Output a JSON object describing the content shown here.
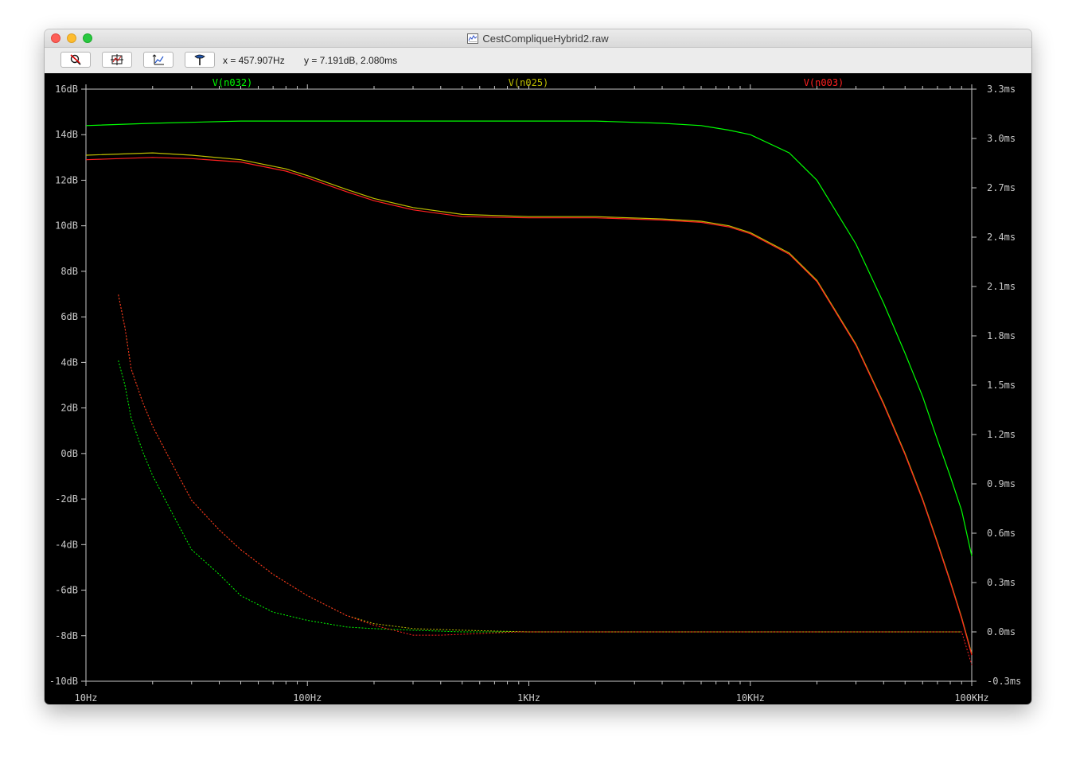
{
  "window": {
    "title": "CestCompliqueHybrid2.raw"
  },
  "toolbar": {
    "buttons": [
      {
        "name": "zoom-cancel-button",
        "icon": "zoom-cancel-icon"
      },
      {
        "name": "autorange-button",
        "icon": "autorange-icon"
      },
      {
        "name": "autorange-y-button",
        "icon": "autorange-y-icon"
      },
      {
        "name": "marker-button",
        "icon": "marker-icon"
      }
    ],
    "x_readout": "x = 457.907Hz",
    "y_readout": "y = 7.191dB, 2.080ms"
  },
  "colors": {
    "background": "#000000",
    "axis": "#c8c8c8",
    "grid": "#404040",
    "v_n032": "#00ff00",
    "v_n025": "#bfbf00",
    "v_n003": "#ff2020"
  },
  "chart_data": {
    "type": "line",
    "xscale": "log",
    "xlim_hz": [
      10,
      100000
    ],
    "x_tick_labels": [
      "10Hz",
      "100Hz",
      "1KHz",
      "10KHz",
      "100KHz"
    ],
    "left_ylim_db": [
      -10,
      16
    ],
    "left_tick_labels": [
      "16dB",
      "14dB",
      "12dB",
      "10dB",
      "8dB",
      "6dB",
      "4dB",
      "2dB",
      "0dB",
      "-2dB",
      "-4dB",
      "-6dB",
      "-8dB",
      "-10dB"
    ],
    "right_ylim_ms": [
      -0.3,
      3.3
    ],
    "right_tick_labels": [
      "3.3ms",
      "3.0ms",
      "2.7ms",
      "2.4ms",
      "2.1ms",
      "1.8ms",
      "1.5ms",
      "1.2ms",
      "0.9ms",
      "0.6ms",
      "0.3ms",
      "0.0ms",
      "-0.3ms"
    ],
    "legend": [
      "V(n032)",
      "V(n025)",
      "V(n003)"
    ],
    "series": [
      {
        "name": "V(n032)",
        "magnitude_db": [
          [
            10,
            14.4
          ],
          [
            20,
            14.5
          ],
          [
            50,
            14.6
          ],
          [
            100,
            14.6
          ],
          [
            200,
            14.6
          ],
          [
            500,
            14.6
          ],
          [
            1000,
            14.6
          ],
          [
            2000,
            14.6
          ],
          [
            4000,
            14.5
          ],
          [
            6000,
            14.4
          ],
          [
            8000,
            14.2
          ],
          [
            10000,
            14.0
          ],
          [
            15000,
            13.2
          ],
          [
            20000,
            12.0
          ],
          [
            30000,
            9.2
          ],
          [
            40000,
            6.6
          ],
          [
            50000,
            4.4
          ],
          [
            60000,
            2.5
          ],
          [
            70000,
            0.6
          ],
          [
            80000,
            -1.0
          ],
          [
            90000,
            -2.5
          ],
          [
            100000,
            -4.5
          ]
        ],
        "group_delay_ms": [
          [
            14,
            1.65
          ],
          [
            15,
            1.5
          ],
          [
            16,
            1.3
          ],
          [
            18,
            1.1
          ],
          [
            20,
            0.95
          ],
          [
            25,
            0.7
          ],
          [
            30,
            0.5
          ],
          [
            40,
            0.35
          ],
          [
            50,
            0.22
          ],
          [
            70,
            0.12
          ],
          [
            100,
            0.07
          ],
          [
            150,
            0.03
          ],
          [
            200,
            0.02
          ],
          [
            300,
            0.01
          ],
          [
            500,
            0.0
          ],
          [
            1000,
            0.0
          ],
          [
            10000,
            0.0
          ],
          [
            90000,
            0.0
          ]
        ]
      },
      {
        "name": "V(n025)",
        "magnitude_db": [
          [
            10,
            13.1
          ],
          [
            20,
            13.2
          ],
          [
            30,
            13.1
          ],
          [
            50,
            12.9
          ],
          [
            80,
            12.5
          ],
          [
            100,
            12.2
          ],
          [
            150,
            11.6
          ],
          [
            200,
            11.2
          ],
          [
            300,
            10.8
          ],
          [
            500,
            10.5
          ],
          [
            1000,
            10.4
          ],
          [
            2000,
            10.4
          ],
          [
            4000,
            10.3
          ],
          [
            6000,
            10.2
          ],
          [
            8000,
            10.0
          ],
          [
            10000,
            9.7
          ],
          [
            15000,
            8.8
          ],
          [
            20000,
            7.6
          ],
          [
            30000,
            4.8
          ],
          [
            40000,
            2.2
          ],
          [
            50000,
            0.0
          ],
          [
            60000,
            -2.0
          ],
          [
            70000,
            -3.9
          ],
          [
            80000,
            -5.6
          ],
          [
            90000,
            -7.2
          ],
          [
            100000,
            -8.8
          ]
        ],
        "group_delay_ms": [
          [
            14,
            2.05
          ],
          [
            15,
            1.85
          ],
          [
            16,
            1.6
          ],
          [
            18,
            1.4
          ],
          [
            20,
            1.25
          ],
          [
            25,
            1.0
          ],
          [
            30,
            0.8
          ],
          [
            40,
            0.62
          ],
          [
            50,
            0.5
          ],
          [
            70,
            0.35
          ],
          [
            100,
            0.22
          ],
          [
            150,
            0.1
          ],
          [
            200,
            0.05
          ],
          [
            300,
            0.02
          ],
          [
            500,
            0.01
          ],
          [
            1000,
            0.0
          ],
          [
            10000,
            0.0
          ],
          [
            90000,
            0.0
          ]
        ]
      },
      {
        "name": "V(n003)",
        "magnitude_db": [
          [
            10,
            12.9
          ],
          [
            20,
            13.0
          ],
          [
            30,
            12.95
          ],
          [
            50,
            12.8
          ],
          [
            80,
            12.4
          ],
          [
            100,
            12.1
          ],
          [
            150,
            11.5
          ],
          [
            200,
            11.1
          ],
          [
            300,
            10.7
          ],
          [
            500,
            10.4
          ],
          [
            1000,
            10.35
          ],
          [
            2000,
            10.35
          ],
          [
            4000,
            10.25
          ],
          [
            6000,
            10.15
          ],
          [
            8000,
            9.95
          ],
          [
            10000,
            9.65
          ],
          [
            15000,
            8.75
          ],
          [
            20000,
            7.55
          ],
          [
            30000,
            4.75
          ],
          [
            40000,
            2.15
          ],
          [
            50000,
            -0.05
          ],
          [
            60000,
            -2.05
          ],
          [
            70000,
            -3.95
          ],
          [
            80000,
            -5.65
          ],
          [
            90000,
            -7.25
          ],
          [
            100000,
            -8.85
          ]
        ],
        "group_delay_ms": [
          [
            14,
            2.05
          ],
          [
            15,
            1.85
          ],
          [
            16,
            1.6
          ],
          [
            18,
            1.4
          ],
          [
            20,
            1.25
          ],
          [
            25,
            1.0
          ],
          [
            30,
            0.8
          ],
          [
            40,
            0.62
          ],
          [
            50,
            0.5
          ],
          [
            70,
            0.35
          ],
          [
            100,
            0.22
          ],
          [
            150,
            0.1
          ],
          [
            200,
            0.04
          ],
          [
            300,
            -0.02
          ],
          [
            400,
            -0.02
          ],
          [
            600,
            -0.01
          ],
          [
            900,
            0.0
          ],
          [
            1000,
            0.0
          ],
          [
            10000,
            0.0
          ],
          [
            90000,
            0.0
          ],
          [
            100000,
            -0.2
          ]
        ]
      }
    ]
  }
}
